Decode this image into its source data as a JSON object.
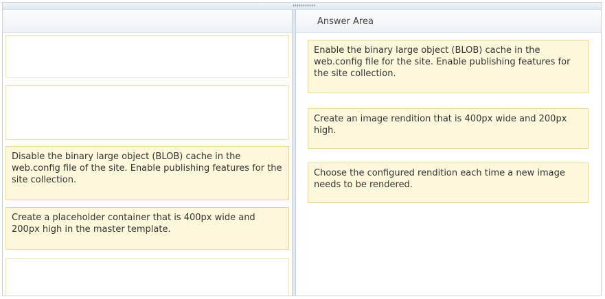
{
  "answer_area": {
    "title": "Answer Area"
  },
  "source_items": [
    {
      "text": ""
    },
    {
      "text": ""
    },
    {
      "text": "Disable the binary large object (BLOB) cache in the web.config file of the site. Enable publishing features for the site collection."
    },
    {
      "text": "Create a placeholder container that is 400px wide and 200px high in the master template."
    },
    {
      "text": ""
    }
  ],
  "answer_items": [
    {
      "text": "Enable the binary large object (BLOB) cache in the web.config file for the site. Enable publishing features for the site collection."
    },
    {
      "text": "Create an image rendition that is 400px wide and 200px high."
    },
    {
      "text": "Choose the configured rendition each time a new image needs to be rendered."
    }
  ]
}
